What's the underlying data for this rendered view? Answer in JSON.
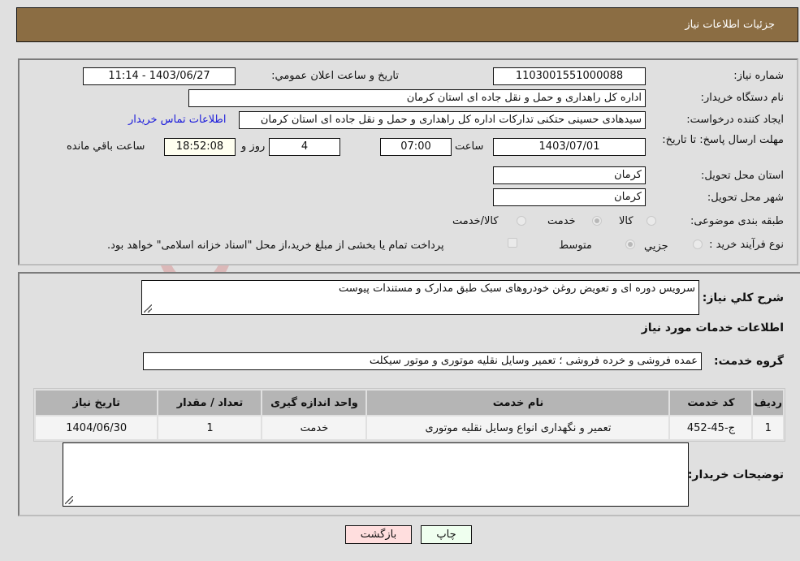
{
  "header": {
    "title": "جزئیات اطلاعات نیاز"
  },
  "details": {
    "need_number_label": "شماره نیاز:",
    "need_number": "1103001551000088",
    "announce_label": "تاریخ و ساعت اعلان عمومي:",
    "announce_value": "1403/06/27 - 11:14",
    "buyer_org_label": "نام دستگاه خریدار:",
    "buyer_org": "اداره کل راهداری و حمل و نقل جاده ای استان کرمان",
    "creator_label": "ایجاد کننده درخواست:",
    "creator": "سیدهادی حسینی حتکنی تدارکات اداره کل راهداری و حمل و نقل جاده ای استان کرمان",
    "contact_link": "اطلاعات تماس خریدار",
    "deadline_label": "مهلت ارسال پاسخ: تا تاریخ:",
    "deadline_date": "1403/07/01",
    "time_label": "ساعت",
    "deadline_time": "07:00",
    "days_value": "4",
    "days_label": "روز و",
    "remaining_time": "18:52:08",
    "remaining_label": "ساعت باقي مانده",
    "province_label": "استان محل تحویل:",
    "province": "کرمان",
    "city_label": "شهر محل تحویل:",
    "city": "کرمان",
    "category_label": "طبقه بندی موضوعی:",
    "category_options": [
      "کالا",
      "خدمت",
      "کالا/خدمت"
    ],
    "category_selected": "خدمت",
    "process_label": "نوع فرآیند خرید :",
    "process_options": [
      "جزيي",
      "متوسط"
    ],
    "process_selected": "متوسط",
    "treasury_note": "پرداخت تمام یا بخشی از مبلغ خرید،از محل \"اسناد خزانه اسلامی\" خواهد بود."
  },
  "summary": {
    "description_label": "شرح کلي نیاز:",
    "description": "سرویس دوره ای و تعویض روغن خودروهای سبک طبق مدارک و مستندات پیوست",
    "services_heading": "اطلاعات خدمات مورد نیاز",
    "service_group_label": "گروه خدمت:",
    "service_group": "عمده فروشی و خرده فروشی ؛ تعمیر وسایل نقلیه موتوری و موتور سیکلت",
    "table": {
      "headers": [
        "ردیف",
        "کد خدمت",
        "نام خدمت",
        "واحد اندازه گیری",
        "تعداد / مقدار",
        "تاریخ نیاز"
      ],
      "rows": [
        [
          "1",
          "ج-45-452",
          "تعمیر و نگهداری انواع وسایل نقلیه موتوری",
          "خدمت",
          "1",
          "1404/06/30"
        ]
      ]
    },
    "buyer_notes_label": "توضیحات خریدار:",
    "buyer_notes": ""
  },
  "buttons": {
    "print": "چاپ",
    "back": "بازگشت"
  },
  "watermark": "AriaTender.neT",
  "colors": {
    "header_bg": "#8b6d43",
    "print_bg": "#efffef",
    "back_bg": "#ffdede",
    "link": "#1a1adb"
  }
}
